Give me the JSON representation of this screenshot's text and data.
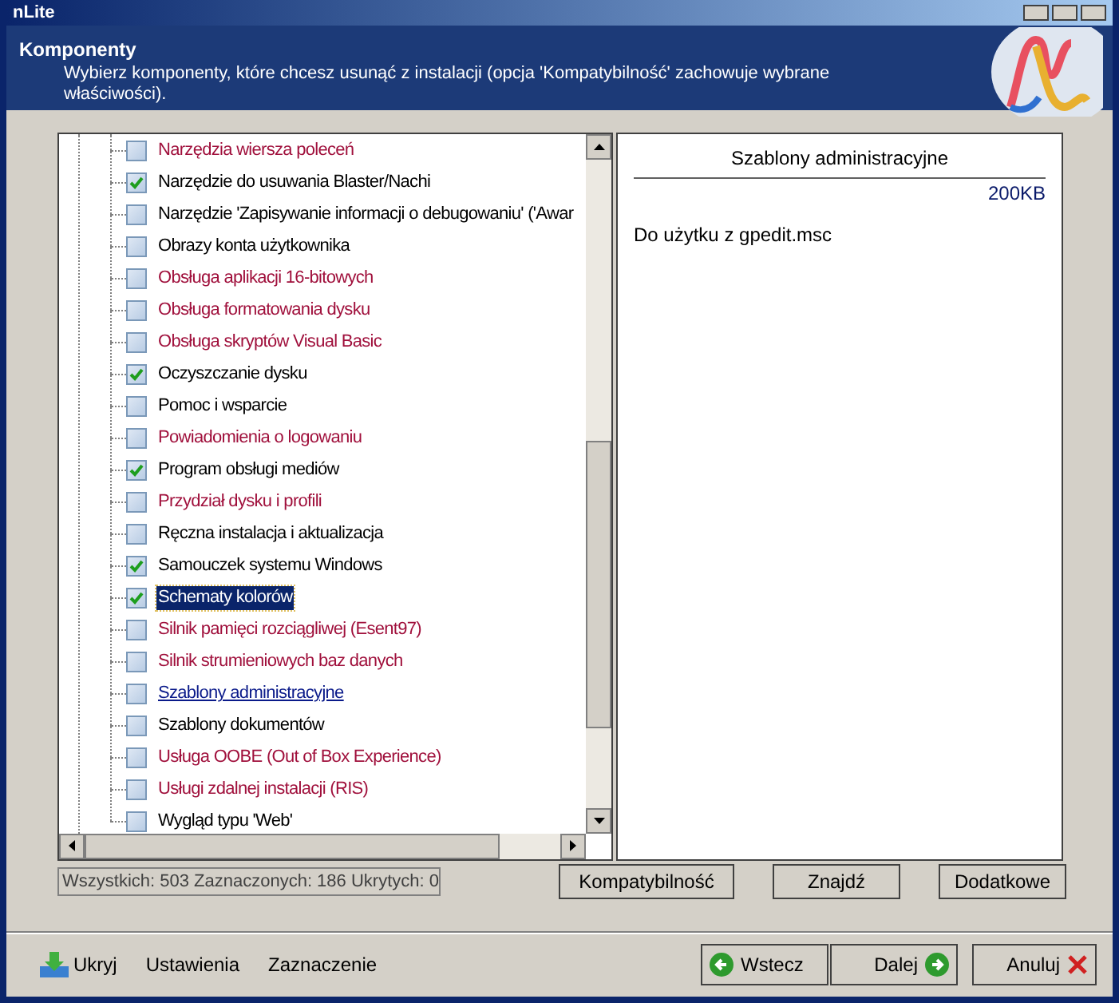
{
  "window": {
    "title": "nLite"
  },
  "header": {
    "title": "Komponenty",
    "subtitle": "Wybierz komponenty, które chcesz usunąć z instalacji (opcja 'Kompatybilność' zachowuje wybrane właściwości)."
  },
  "tree": {
    "items": [
      {
        "label": "Narzędzia wiersza poleceń",
        "kind": "warning",
        "checked": false,
        "selected": false
      },
      {
        "label": "Narzędzie do usuwania Blaster/Nachi",
        "kind": "normal",
        "checked": true,
        "selected": false
      },
      {
        "label": "Narzędzie 'Zapisywanie informacji o debugowaniu' ('Awar",
        "kind": "normal",
        "checked": false,
        "selected": false
      },
      {
        "label": "Obrazy konta użytkownika",
        "kind": "normal",
        "checked": false,
        "selected": false
      },
      {
        "label": "Obsługa aplikacji 16-bitowych",
        "kind": "warning",
        "checked": false,
        "selected": false
      },
      {
        "label": "Obsługa formatowania dysku",
        "kind": "warning",
        "checked": false,
        "selected": false
      },
      {
        "label": "Obsługa skryptów Visual Basic",
        "kind": "warning",
        "checked": false,
        "selected": false
      },
      {
        "label": "Oczyszczanie dysku",
        "kind": "normal",
        "checked": true,
        "selected": false
      },
      {
        "label": "Pomoc i wsparcie",
        "kind": "normal",
        "checked": false,
        "selected": false
      },
      {
        "label": "Powiadomienia o logowaniu",
        "kind": "warning",
        "checked": false,
        "selected": false
      },
      {
        "label": "Program obsługi mediów",
        "kind": "normal",
        "checked": true,
        "selected": false
      },
      {
        "label": "Przydział dysku i profili",
        "kind": "warning",
        "checked": false,
        "selected": false
      },
      {
        "label": "Ręczna instalacja i aktualizacja",
        "kind": "normal",
        "checked": false,
        "selected": false
      },
      {
        "label": "Samouczek systemu Windows",
        "kind": "normal",
        "checked": true,
        "selected": false
      },
      {
        "label": "Schematy kolorów",
        "kind": "normal",
        "checked": true,
        "selected": true
      },
      {
        "label": "Silnik pamięci rozciągliwej (Esent97)",
        "kind": "warning",
        "checked": false,
        "selected": false
      },
      {
        "label": "Silnik strumieniowych baz danych",
        "kind": "warning",
        "checked": false,
        "selected": false
      },
      {
        "label": "Szablony administracyjne",
        "kind": "hover",
        "checked": false,
        "selected": false
      },
      {
        "label": "Szablony dokumentów",
        "kind": "normal",
        "checked": false,
        "selected": false
      },
      {
        "label": "Usługa OOBE (Out of Box Experience)",
        "kind": "warning",
        "checked": false,
        "selected": false
      },
      {
        "label": "Usługi zdalnej instalacji (RIS)",
        "kind": "warning",
        "checked": false,
        "selected": false
      },
      {
        "label": "Wygląd typu 'Web'",
        "kind": "normal",
        "checked": false,
        "selected": false
      }
    ]
  },
  "details": {
    "title": "Szablony administracyjne",
    "size": "200KB",
    "description": "Do użytku z gpedit.msc"
  },
  "status": "Wszystkich: 503 Zaznaczonych: 186 Ukrytych: 0",
  "panel_buttons": [
    "Kompatybilność",
    "Znajdź",
    "Dodatkowe"
  ],
  "footer_links": [
    "Ukryj",
    "Ustawienia",
    "Zaznaczenie"
  ],
  "nav_buttons": [
    {
      "label": "Wstecz",
      "kind": "back"
    },
    {
      "label": "Dalej",
      "kind": "next"
    },
    {
      "label": "Anuluj",
      "kind": "cancel"
    }
  ]
}
